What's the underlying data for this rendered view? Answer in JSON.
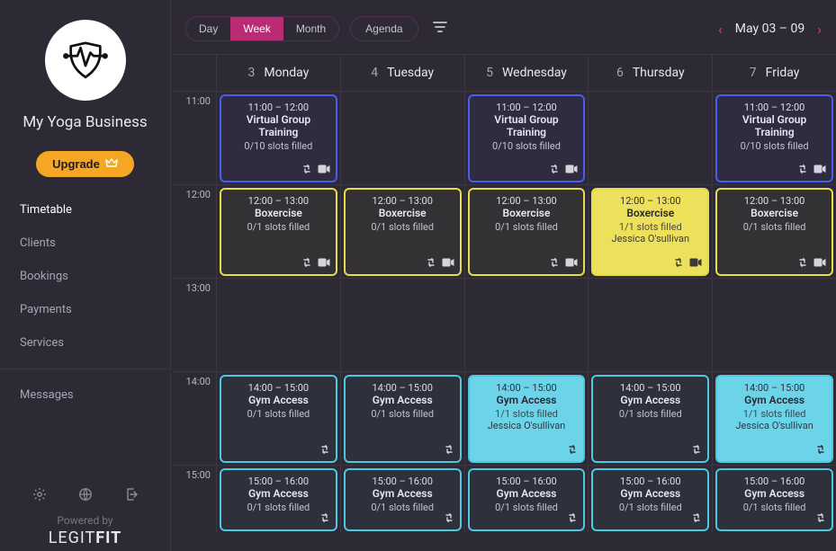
{
  "business_name": "My Yoga Business",
  "sidebar": {
    "upgrade_label": "Upgrade",
    "items": [
      {
        "label": "Timetable",
        "active": true
      },
      {
        "label": "Clients"
      },
      {
        "label": "Bookings"
      },
      {
        "label": "Payments"
      },
      {
        "label": "Services"
      },
      {
        "label": "Messages"
      }
    ],
    "powered_by": "Powered by",
    "brand_light": "LEGIT",
    "brand_bold": "FIT"
  },
  "toolbar": {
    "views": {
      "day": "Day",
      "week": "Week",
      "month": "Month"
    },
    "active_view": "week",
    "agenda": "Agenda",
    "date_range": "May 03 – 09"
  },
  "days": [
    {
      "num": "3",
      "name": "Monday"
    },
    {
      "num": "4",
      "name": "Tuesday"
    },
    {
      "num": "5",
      "name": "Wednesday"
    },
    {
      "num": "6",
      "name": "Thursday"
    },
    {
      "num": "7",
      "name": "Friday"
    }
  ],
  "hours": [
    "11:00",
    "12:00",
    "13:00",
    "14:00",
    "15:00"
  ],
  "events": {
    "11": {
      "mon": {
        "time": "11:00 – 12:00",
        "title": "Virtual Group Training",
        "slots": "0/10 slots filled",
        "variant": "blue",
        "repeat": true,
        "video": true
      },
      "wed": {
        "time": "11:00 – 12:00",
        "title": "Virtual Group Training",
        "slots": "0/10 slots filled",
        "variant": "blue",
        "repeat": true,
        "video": true
      },
      "fri": {
        "time": "11:00 – 12:00",
        "title": "Virtual Group Training",
        "slots": "0/10 slots filled",
        "variant": "blue",
        "repeat": true,
        "video": true
      }
    },
    "12": {
      "mon": {
        "time": "12:00 – 13:00",
        "title": "Boxercise",
        "slots": "0/1 slots filled",
        "variant": "yellow",
        "repeat": true,
        "video": true
      },
      "tue": {
        "time": "12:00 – 13:00",
        "title": "Boxercise",
        "slots": "0/1 slots filled",
        "variant": "yellow",
        "repeat": true,
        "video": true
      },
      "wed": {
        "time": "12:00 – 13:00",
        "title": "Boxercise",
        "slots": "0/1 slots filled",
        "variant": "yellow",
        "repeat": true,
        "video": true
      },
      "thu": {
        "time": "12:00 – 13:00",
        "title": "Boxercise",
        "slots": "1/1 slots filled",
        "attendee": "Jessica O'sullivan",
        "variant": "yellow-fill",
        "repeat": true,
        "video": true
      },
      "fri": {
        "time": "12:00 – 13:00",
        "title": "Boxercise",
        "slots": "0/1 slots filled",
        "variant": "yellow",
        "repeat": true,
        "video": true
      }
    },
    "14": {
      "mon": {
        "time": "14:00 – 15:00",
        "title": "Gym Access",
        "slots": "0/1 slots filled",
        "variant": "cyan",
        "repeat": true
      },
      "tue": {
        "time": "14:00 – 15:00",
        "title": "Gym Access",
        "slots": "0/1 slots filled",
        "variant": "cyan",
        "repeat": true
      },
      "wed": {
        "time": "14:00 – 15:00",
        "title": "Gym Access",
        "slots": "1/1 slots filled",
        "attendee": "Jessica O'sullivan",
        "variant": "cyan-fill",
        "repeat": true
      },
      "thu": {
        "time": "14:00 – 15:00",
        "title": "Gym Access",
        "slots": "0/1 slots filled",
        "variant": "cyan",
        "repeat": true
      },
      "fri": {
        "time": "14:00 – 15:00",
        "title": "Gym Access",
        "slots": "1/1 slots filled",
        "attendee": "Jessica O'sullivan",
        "variant": "cyan-fill",
        "repeat": true
      }
    },
    "15": {
      "mon": {
        "time": "15:00 – 16:00",
        "title": "Gym Access",
        "slots": "0/1 slots filled",
        "variant": "cyan",
        "repeat": true
      },
      "tue": {
        "time": "15:00 – 16:00",
        "title": "Gym Access",
        "slots": "0/1 slots filled",
        "variant": "cyan",
        "repeat": true
      },
      "wed": {
        "time": "15:00 – 16:00",
        "title": "Gym Access",
        "slots": "0/1 slots filled",
        "variant": "cyan",
        "repeat": true
      },
      "thu": {
        "time": "15:00 – 16:00",
        "title": "Gym Access",
        "slots": "0/1 slots filled",
        "variant": "cyan",
        "repeat": true
      },
      "fri": {
        "time": "15:00 – 16:00",
        "title": "Gym Access",
        "slots": "0/1 slots filled",
        "variant": "cyan",
        "repeat": true
      }
    }
  }
}
